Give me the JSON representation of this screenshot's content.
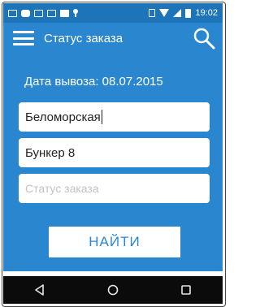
{
  "status_bar": {
    "time": "19:02",
    "left_icons": [
      "mail-icon",
      "chat-icon",
      "image-icon",
      "mail-icon",
      "bag-icon",
      "pin-icon"
    ],
    "right_icons": [
      "vibrate-icon",
      "wifi-icon",
      "signal-icon",
      "battery-icon"
    ]
  },
  "app_bar": {
    "title": "Статус заказа",
    "menu_icon": "hamburger-menu-icon",
    "search_icon": "search-icon"
  },
  "form": {
    "pickup_date_label": "Дата вывоза: 08.07.2015",
    "street_value": "Беломорская",
    "bunker_value": "Бункер 8",
    "status_placeholder": "Статус заказа",
    "find_button_label": "НАЙТИ"
  },
  "nav_bar": {
    "icons": [
      "back-icon",
      "home-icon",
      "recents-icon"
    ]
  },
  "colors": {
    "status_bar": "#1d74b8",
    "app_bar": "#2a87cf",
    "button_text": "#2a87cf",
    "nav_bar": "#0b0b0b"
  }
}
